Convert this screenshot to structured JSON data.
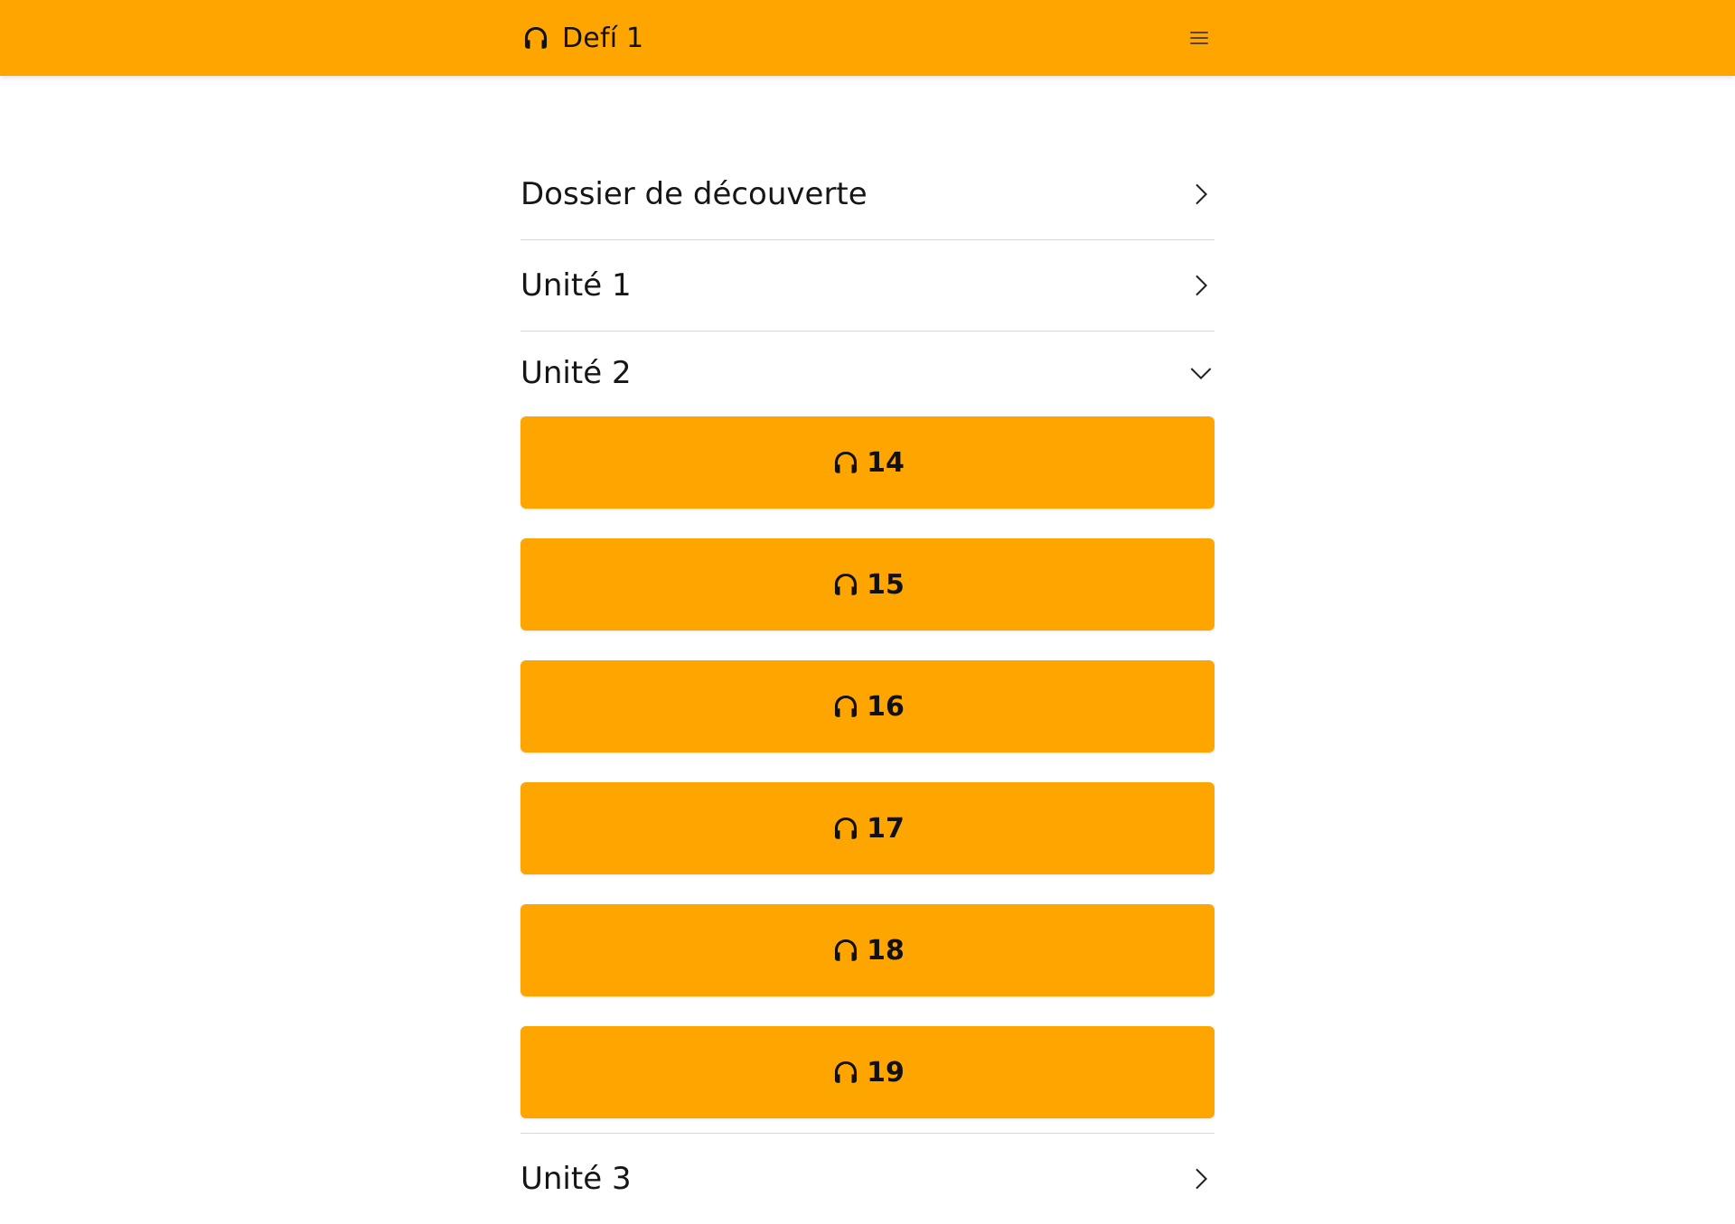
{
  "header": {
    "title": "Defí 1",
    "icon": "headphones-icon",
    "menu_icon": "hamburger-menu-icon",
    "background": "#ffa500"
  },
  "sections": [
    {
      "label": "Dossier de découverte",
      "state": "collapsed"
    },
    {
      "label": "Unité 1",
      "state": "collapsed"
    },
    {
      "label": "Unité 2",
      "state": "expanded"
    },
    {
      "label": "Unité 3",
      "state": "collapsed"
    }
  ],
  "tracks": [
    {
      "number": "14",
      "icon": "headphones-icon"
    },
    {
      "number": "15",
      "icon": "headphones-icon"
    },
    {
      "number": "16",
      "icon": "headphones-icon"
    },
    {
      "number": "17",
      "icon": "headphones-icon"
    },
    {
      "number": "18",
      "icon": "headphones-icon"
    },
    {
      "number": "19",
      "icon": "headphones-icon"
    }
  ],
  "colors": {
    "accent": "#ffa500",
    "divider": "#d8d8d8",
    "text": "#161616"
  }
}
